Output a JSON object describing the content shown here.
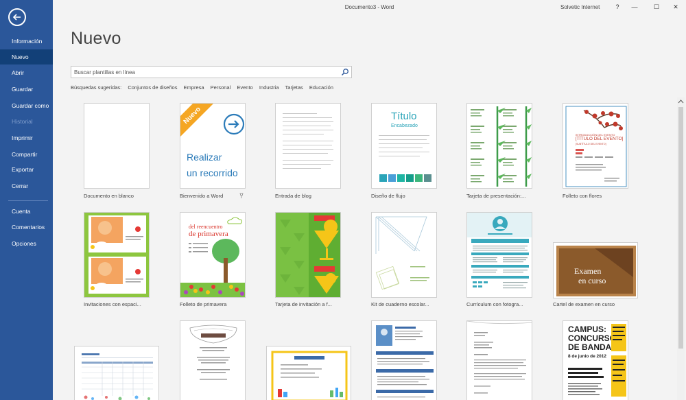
{
  "window": {
    "document_title": "Documento3 - Word",
    "account": "Solvetic Internet",
    "help": "?",
    "minimize": "—",
    "restore": "☐",
    "close": "✕"
  },
  "sidebar": {
    "items": [
      {
        "label": "Información"
      },
      {
        "label": "Nuevo"
      },
      {
        "label": "Abrir"
      },
      {
        "label": "Guardar"
      },
      {
        "label": "Guardar como"
      },
      {
        "label": "Historial"
      },
      {
        "label": "Imprimir"
      },
      {
        "label": "Compartir"
      },
      {
        "label": "Exportar"
      },
      {
        "label": "Cerrar"
      },
      {
        "label": "Cuenta"
      },
      {
        "label": "Comentarios"
      },
      {
        "label": "Opciones"
      }
    ]
  },
  "main": {
    "heading": "Nuevo",
    "search_placeholder": "Buscar plantillas en línea",
    "suggestions_label": "Búsquedas sugeridas:",
    "suggestions": [
      "Conjuntos de diseños",
      "Empresa",
      "Personal",
      "Evento",
      "Industria",
      "Tarjetas",
      "Educación"
    ]
  },
  "templates": {
    "row1": [
      {
        "label": "Documento en blanco"
      },
      {
        "label": "Bienvenido a Word",
        "badge": "Nuevo",
        "text1": "Realizar",
        "text2": "un recorrido"
      },
      {
        "label": "Entrada de blog"
      },
      {
        "label": "Diseño de flujo",
        "title": "Título",
        "subtitle": "Encabezado"
      },
      {
        "label": "Tarjeta de presentación:..."
      },
      {
        "label": "Folleto con flores",
        "intro": "INTRODUCCIÓN DEL EVENTO",
        "event": "[TÍTULO DEL EVENTO]",
        "sub": "[SUBTÍTULO DEL EVENTO]"
      }
    ],
    "row2": [
      {
        "label": "Invitaciones con espaci..."
      },
      {
        "label": "Folleto de primavera",
        "line1": "del reencuentro",
        "line2": "de primavera"
      },
      {
        "label": "Tarjeta de invitación a f..."
      },
      {
        "label": "Kit de cuaderno escolar..."
      },
      {
        "label": "Currículum con fotogra..."
      },
      {
        "label": "Cartel de examen en curso",
        "line1": "Examen",
        "line2": "en curso"
      }
    ],
    "row3": [
      {
        "label": ""
      },
      {
        "label": ""
      },
      {
        "label": ""
      },
      {
        "label": ""
      },
      {
        "label": ""
      },
      {
        "label": "",
        "campus": "CAMPUS:",
        "concurso": "CONCURSO",
        "bandas": "DE BANDAS",
        "date": "8 de junio de 2012"
      }
    ]
  },
  "colors": {
    "sidebar": "#2b579a",
    "sidebar_active": "#124078",
    "tour_blue": "#2b7bb9",
    "badge_orange": "#f5a623",
    "flow_teal": "#2aa4b8",
    "flower_red": "#c0392b",
    "spring_red": "#d9342b",
    "exam_brown": "#8b5a2b"
  }
}
